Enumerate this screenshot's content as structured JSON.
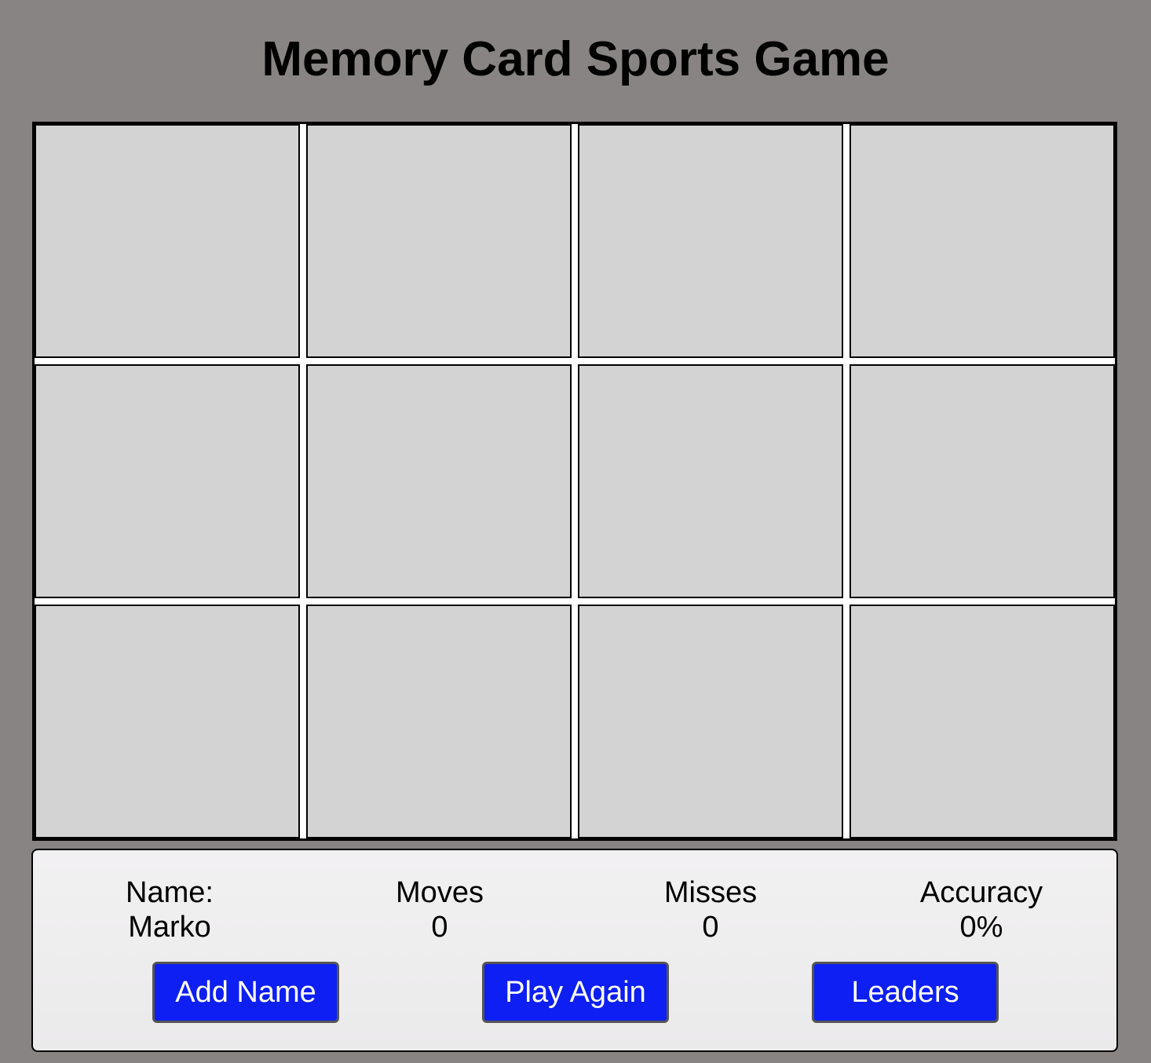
{
  "title": "Memory Card Sports Game",
  "board": {
    "rows": 3,
    "columns": 4,
    "cards": [
      {
        "state": "face-down"
      },
      {
        "state": "face-down"
      },
      {
        "state": "face-down"
      },
      {
        "state": "face-down"
      },
      {
        "state": "face-down"
      },
      {
        "state": "face-down"
      },
      {
        "state": "face-down"
      },
      {
        "state": "face-down"
      },
      {
        "state": "face-down"
      },
      {
        "state": "face-down"
      },
      {
        "state": "face-down"
      },
      {
        "state": "face-down"
      }
    ],
    "card_back_color": "#d3d3d3"
  },
  "stats": {
    "name": {
      "label": "Name:",
      "value": "Marko"
    },
    "moves": {
      "label": "Moves",
      "value": "0"
    },
    "misses": {
      "label": "Misses",
      "value": "0"
    },
    "accuracy": {
      "label": "Accuracy",
      "value": "0%"
    }
  },
  "buttons": {
    "add_name": "Add Name",
    "play_again": "Play Again",
    "leaders": "Leaders"
  },
  "colors": {
    "background": "#878483",
    "button": "#0d1ff2",
    "button_text": "#ffffff"
  }
}
